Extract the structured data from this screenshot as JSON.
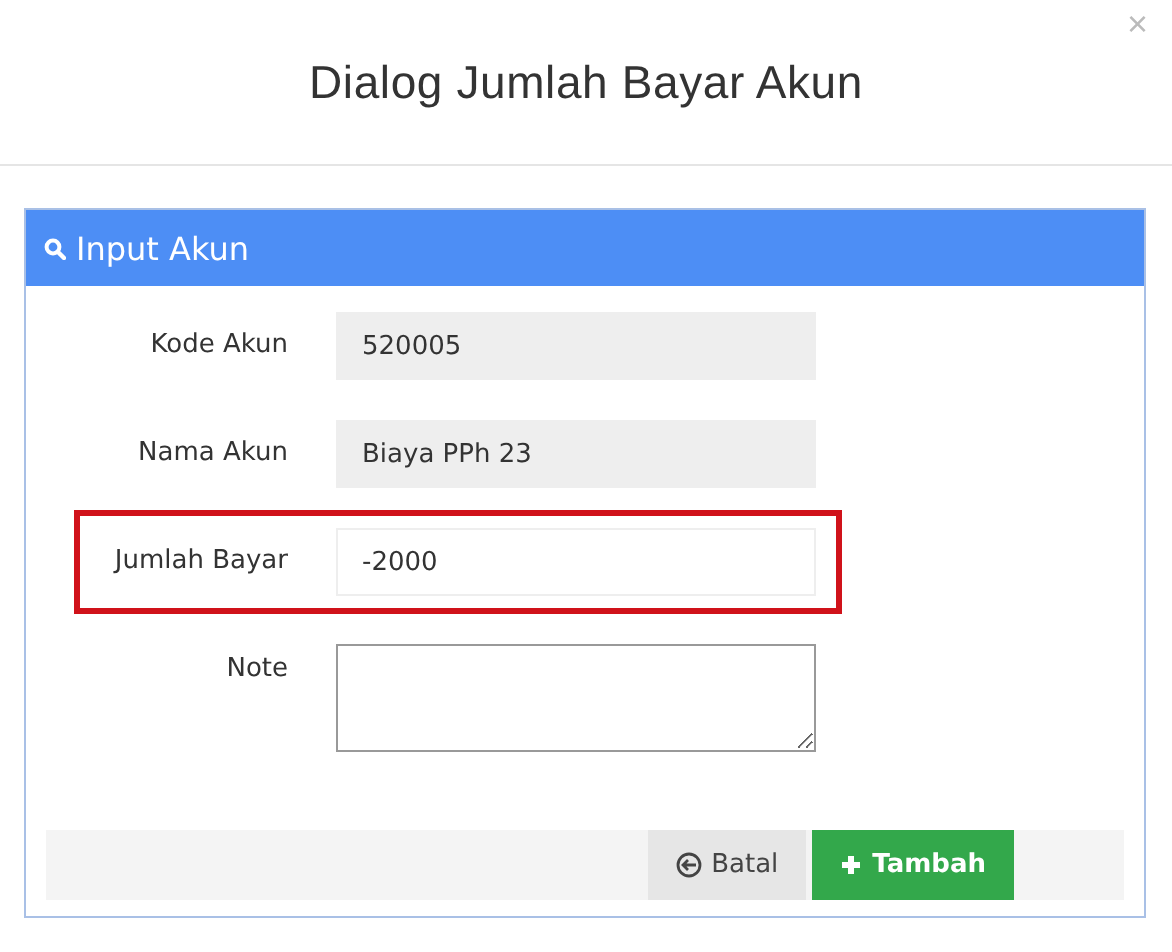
{
  "dialog": {
    "title": "Dialog Jumlah Bayar Akun",
    "close": "×"
  },
  "panel": {
    "title": "Input Akun"
  },
  "fields": [
    {
      "kind": "input",
      "label": "Kode Akun",
      "value": "520005",
      "disabled": true,
      "highlighted": false
    },
    {
      "kind": "input",
      "label": "Nama Akun",
      "value": "Biaya PPh 23",
      "disabled": true,
      "highlighted": false
    },
    {
      "kind": "input",
      "label": "Jumlah Bayar",
      "value": "-2000",
      "disabled": false,
      "highlighted": true
    },
    {
      "kind": "textarea",
      "label": "Note",
      "disabled": false,
      "highlighted": false
    }
  ],
  "buttons": [
    {
      "kind": "cancel",
      "label": "Batal"
    },
    {
      "kind": "add",
      "label": "Tambah"
    }
  ]
}
